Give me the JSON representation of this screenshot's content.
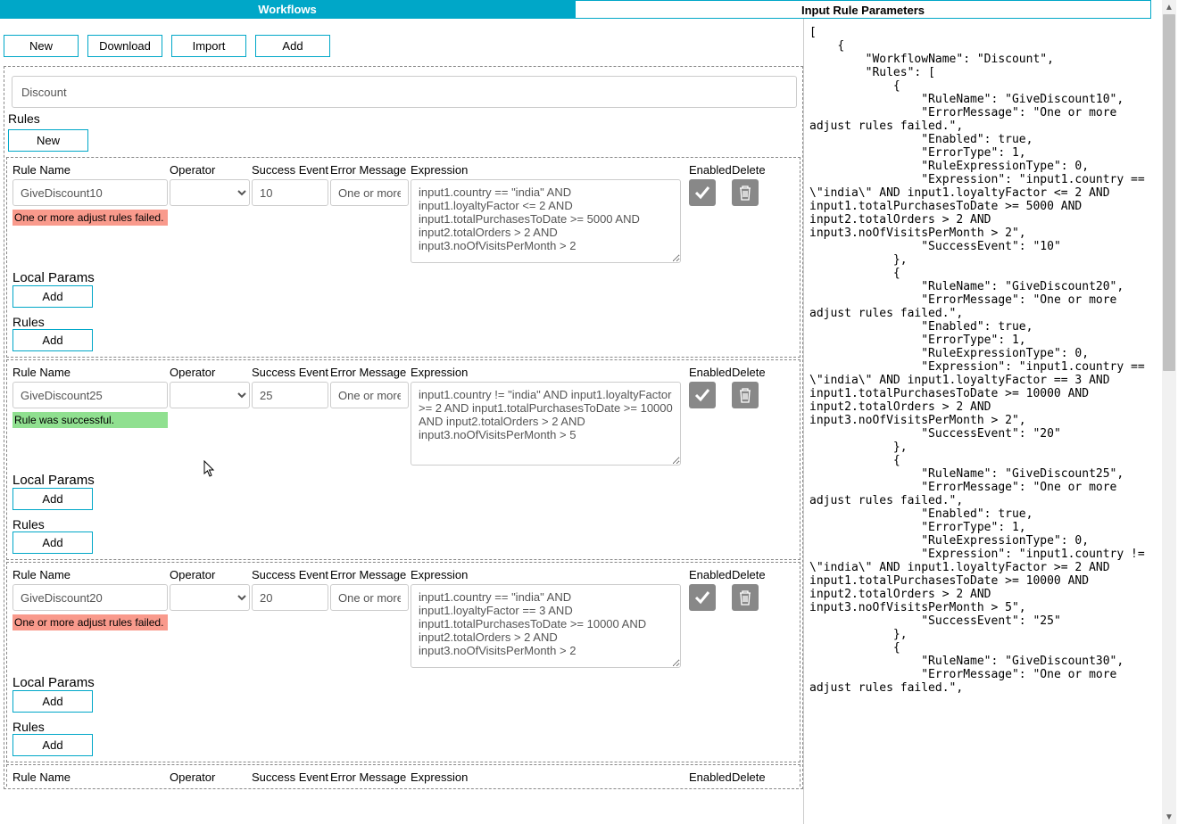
{
  "tabs": {
    "workflows": "Workflows",
    "params": "Input Rule Parameters"
  },
  "toolbar": {
    "new": "New",
    "download": "Download",
    "import": "Import",
    "add": "Add"
  },
  "workflowName": "Discount",
  "labels": {
    "rules": "Rules",
    "new": "New",
    "add": "Add",
    "localParams": "Local Params",
    "ruleName": "Rule Name",
    "operator": "Operator",
    "successEvent": "Success Event",
    "errorMessage": "Error Message",
    "expression": "Expression",
    "enabled": "Enabled",
    "delete": "Delete"
  },
  "status": {
    "fail": "One or more adjust rules failed.",
    "succ": "Rule was successful."
  },
  "rules": [
    {
      "name": "GiveDiscount10",
      "operator": "",
      "successEvent": "10",
      "errorMessage": "One or more",
      "expression": "input1.country == \"india\" AND input1.loyaltyFactor <= 2 AND input1.totalPurchasesToDate >= 5000 AND input2.totalOrders > 2 AND input3.noOfVisitsPerMonth > 2",
      "statusType": "fail"
    },
    {
      "name": "GiveDiscount25",
      "operator": "",
      "successEvent": "25",
      "errorMessage": "One or more",
      "expression": "input1.country != \"india\" AND input1.loyaltyFactor >= 2 AND input1.totalPurchasesToDate >= 10000 AND input2.totalOrders > 2 AND input3.noOfVisitsPerMonth > 5",
      "statusType": "succ"
    },
    {
      "name": "GiveDiscount20",
      "operator": "",
      "successEvent": "20",
      "errorMessage": "One or more",
      "expression": "input1.country == \"india\" AND input1.loyaltyFactor == 3 AND input1.totalPurchasesToDate >= 10000 AND input2.totalOrders > 2 AND input3.noOfVisitsPerMonth > 2",
      "statusType": "fail"
    }
  ],
  "json": "[\n    {\n        \"WorkflowName\": \"Discount\",\n        \"Rules\": [\n            {\n                \"RuleName\": \"GiveDiscount10\",\n                \"ErrorMessage\": \"One or more adjust rules failed.\",\n                \"Enabled\": true,\n                \"ErrorType\": 1,\n                \"RuleExpressionType\": 0,\n                \"Expression\": \"input1.country == \\\"india\\\" AND input1.loyaltyFactor <= 2 AND input1.totalPurchasesToDate >= 5000 AND input2.totalOrders > 2 AND input3.noOfVisitsPerMonth > 2\",\n                \"SuccessEvent\": \"10\"\n            },\n            {\n                \"RuleName\": \"GiveDiscount20\",\n                \"ErrorMessage\": \"One or more adjust rules failed.\",\n                \"Enabled\": true,\n                \"ErrorType\": 1,\n                \"RuleExpressionType\": 0,\n                \"Expression\": \"input1.country == \\\"india\\\" AND input1.loyaltyFactor == 3 AND input1.totalPurchasesToDate >= 10000 AND input2.totalOrders > 2 AND input3.noOfVisitsPerMonth > 2\",\n                \"SuccessEvent\": \"20\"\n            },\n            {\n                \"RuleName\": \"GiveDiscount25\",\n                \"ErrorMessage\": \"One or more adjust rules failed.\",\n                \"Enabled\": true,\n                \"ErrorType\": 1,\n                \"RuleExpressionType\": 0,\n                \"Expression\": \"input1.country != \\\"india\\\" AND input1.loyaltyFactor >= 2 AND input1.totalPurchasesToDate >= 10000 AND input2.totalOrders > 2 AND input3.noOfVisitsPerMonth > 5\",\n                \"SuccessEvent\": \"25\"\n            },\n            {\n                \"RuleName\": \"GiveDiscount30\",\n                \"ErrorMessage\": \"One or more adjust rules failed.\","
}
